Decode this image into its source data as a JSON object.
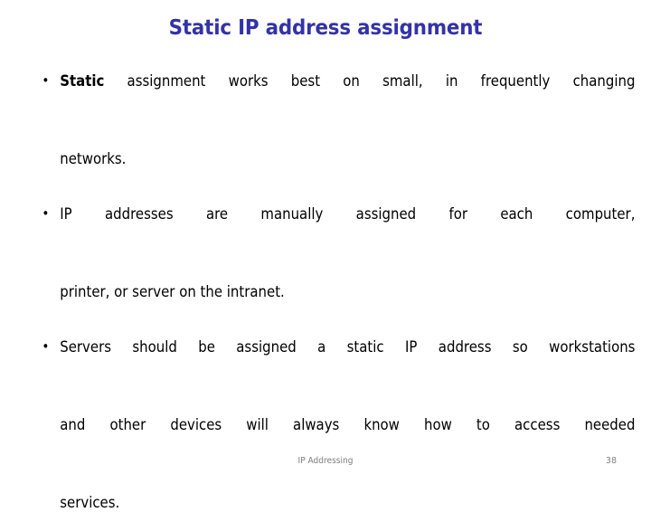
{
  "slide": {
    "title": "Static IP address assignment",
    "title_color": "#3333A8",
    "background_color": "#FFFFFF",
    "body_text_color": "#000000",
    "bullet_glyph": "•",
    "bullets": [
      {
        "lead_bold": "Static",
        "rest": " assignment works best on small, in frequently changing",
        "continuation": "networks.",
        "full_text": "Static assignment works best on small, in frequently changing networks."
      },
      {
        "lead_bold": "",
        "rest": "IP addresses are manually assigned for each computer,",
        "continuation": "printer, or server on the intranet.",
        "full_text": "IP addresses are manually assigned for each computer, printer, or server on the intranet."
      },
      {
        "lead_bold": "",
        "rest": "Servers should be assigned a static IP address so workstations",
        "continuation": "and other devices will always know how to access needed",
        "continuation2": "services.",
        "full_text": "Servers should be assigned a static IP address so workstations and other devices will always know how to access needed services."
      }
    ]
  },
  "footer": {
    "label": "IP Addressing",
    "page_number": "38",
    "color": "#7F7F7F"
  }
}
